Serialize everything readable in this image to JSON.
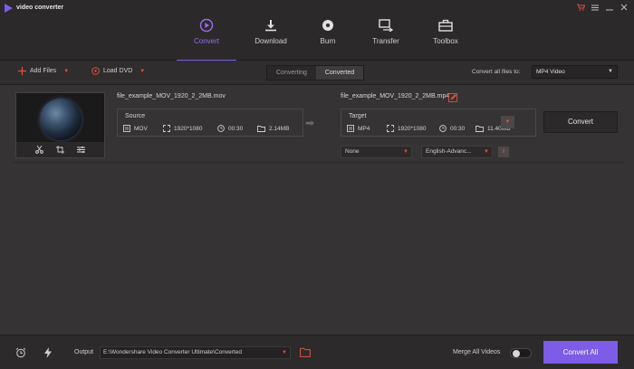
{
  "app": {
    "title": "video converter"
  },
  "window": {
    "cart_icon": "cart-icon",
    "menu_icon": "menu-icon",
    "minimize_icon": "minimize-icon",
    "close_icon": "close-icon"
  },
  "nav": {
    "items": [
      {
        "label": "Convert",
        "icon": "play-circle-icon",
        "active": true
      },
      {
        "label": "Download",
        "icon": "download-icon"
      },
      {
        "label": "Burn",
        "icon": "disc-icon"
      },
      {
        "label": "Transfer",
        "icon": "transfer-icon"
      },
      {
        "label": "Toolbox",
        "icon": "toolbox-icon"
      }
    ]
  },
  "toolbar": {
    "add_files": "Add Files",
    "load_dvd": "Load DVD",
    "tabs": [
      "Converting",
      "Converted"
    ],
    "convert_all_label": "Convert all files to:",
    "convert_all_format": "MP4 Video"
  },
  "file": {
    "source_name": "file_example_MOV_1920_2_2MB.mov",
    "target_name": "file_example_MOV_1920_2_2MB.mp4",
    "source": {
      "title": "Source",
      "format": "MOV",
      "resolution": "1920*1080",
      "duration": "00:30",
      "size": "2.14MB"
    },
    "target": {
      "title": "Target",
      "format": "MP4",
      "resolution": "1920*1080",
      "duration": "00:30",
      "size": "11.40MB"
    },
    "subtitle": "None",
    "audio": "English-Advanc...",
    "convert_label": "Convert"
  },
  "bottom": {
    "output_label": "Output",
    "output_path": "E:\\Wondershare Video Converter Ultimate\\Converted",
    "merge_label": "Merge All Videos",
    "merge_on": false,
    "convert_all": "Convert All"
  },
  "colors": {
    "accent": "#7d5ce8",
    "highlight": "#e0513d"
  }
}
